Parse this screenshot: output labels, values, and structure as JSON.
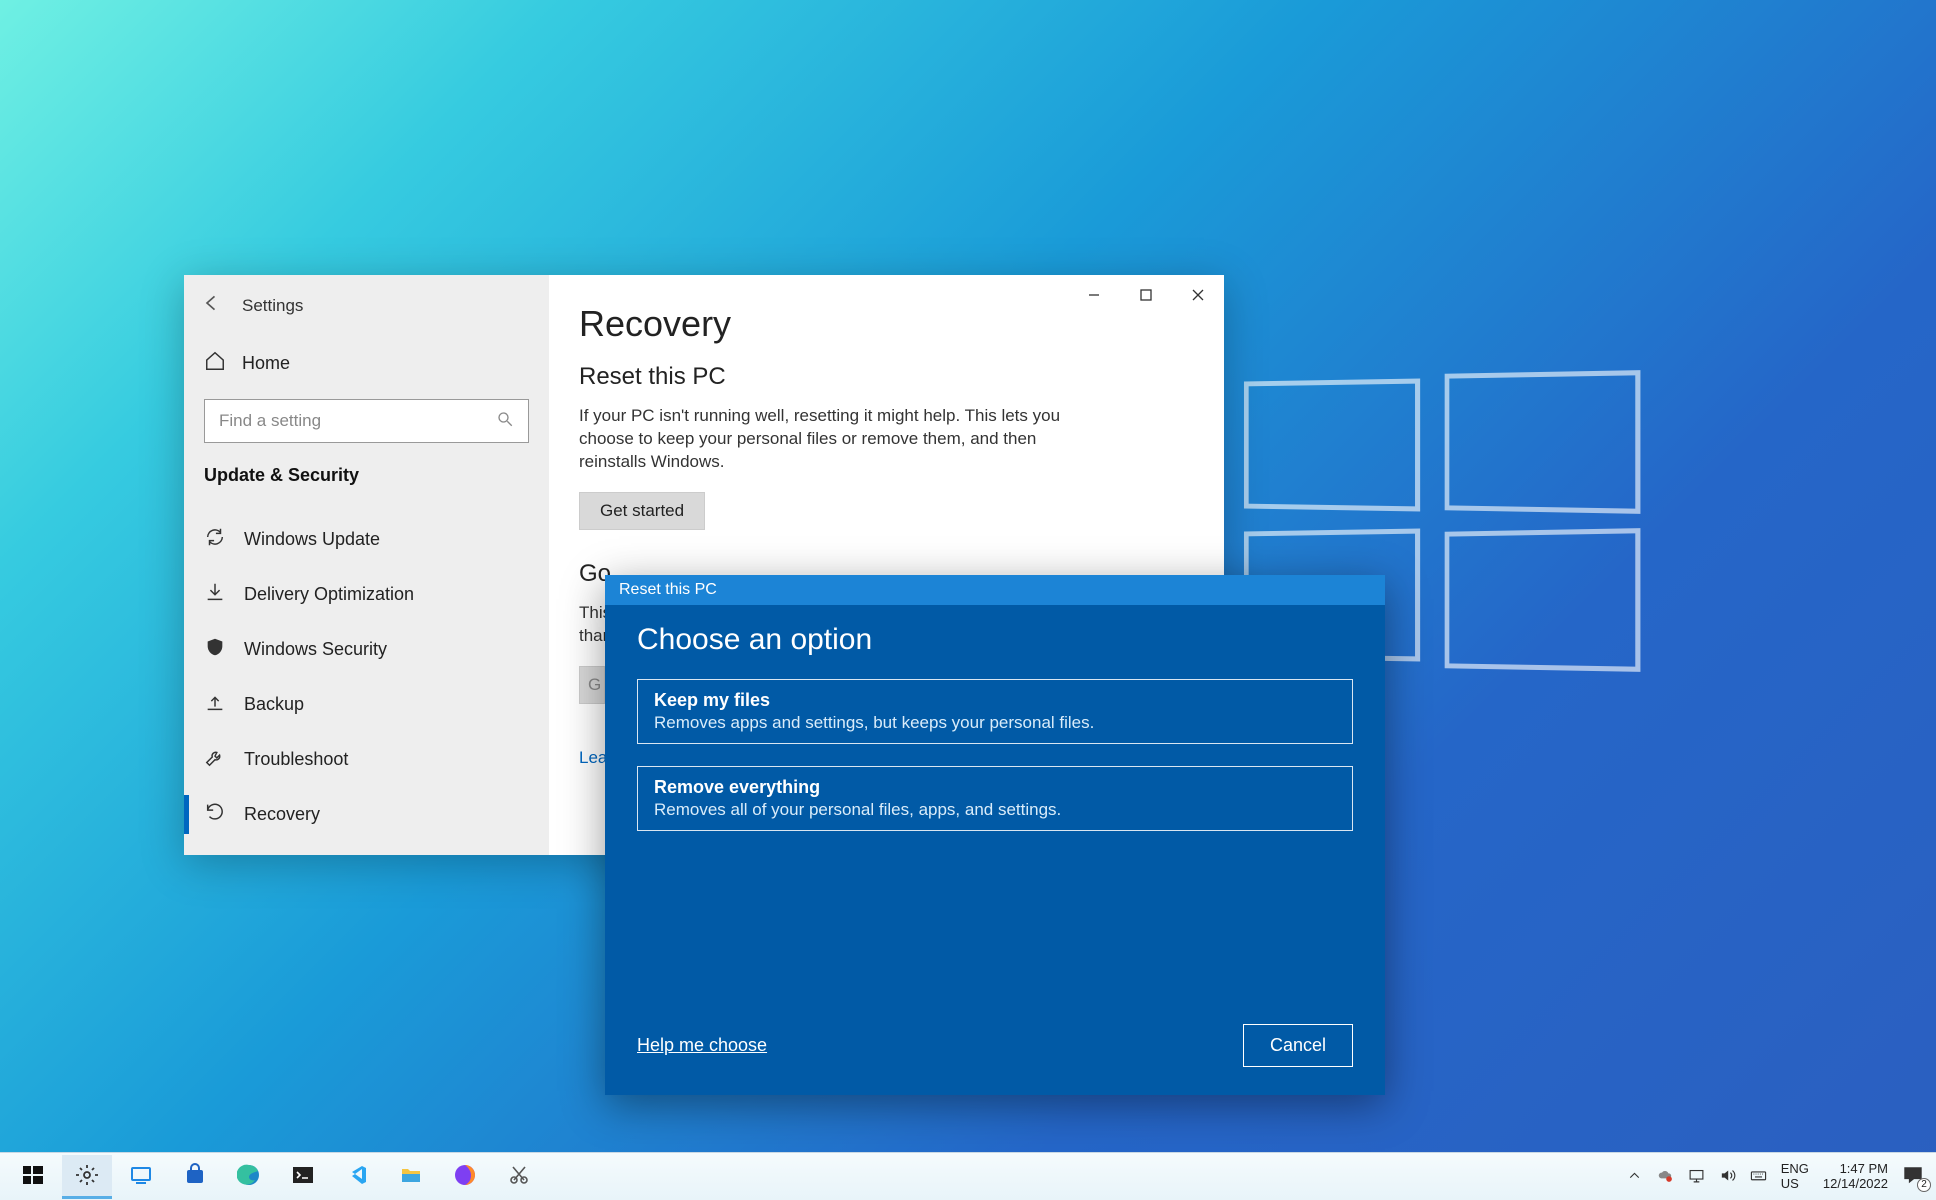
{
  "settings": {
    "title": "Settings",
    "home": "Home",
    "search_placeholder": "Find a setting",
    "category": "Update & Security",
    "nav": {
      "windows_update": "Windows Update",
      "delivery_optimization": "Delivery Optimization",
      "windows_security": "Windows Security",
      "backup": "Backup",
      "troubleshoot": "Troubleshoot",
      "recovery": "Recovery"
    },
    "page": {
      "title": "Recovery",
      "reset_heading": "Reset this PC",
      "reset_body": "If your PC isn't running well, resetting it might help. This lets you choose to keep your personal files or remove them, and then reinstalls Windows.",
      "get_started": "Get started",
      "go_partial": "Go",
      "advanced_body_partial": "This\nthan",
      "advanced_button_partial": "G",
      "learn_link_partial": "Learn"
    }
  },
  "reset_dialog": {
    "titlebar": "Reset this PC",
    "heading": "Choose an option",
    "opt1_title": "Keep my files",
    "opt1_desc": "Removes apps and settings, but keeps your personal files.",
    "opt2_title": "Remove everything",
    "opt2_desc": "Removes all of your personal files, apps, and settings.",
    "help": "Help me choose",
    "cancel": "Cancel"
  },
  "taskbar": {
    "lang_line1": "ENG",
    "lang_line2": "US",
    "time": "1:47 PM",
    "date": "12/14/2022",
    "notif_count": "2"
  }
}
